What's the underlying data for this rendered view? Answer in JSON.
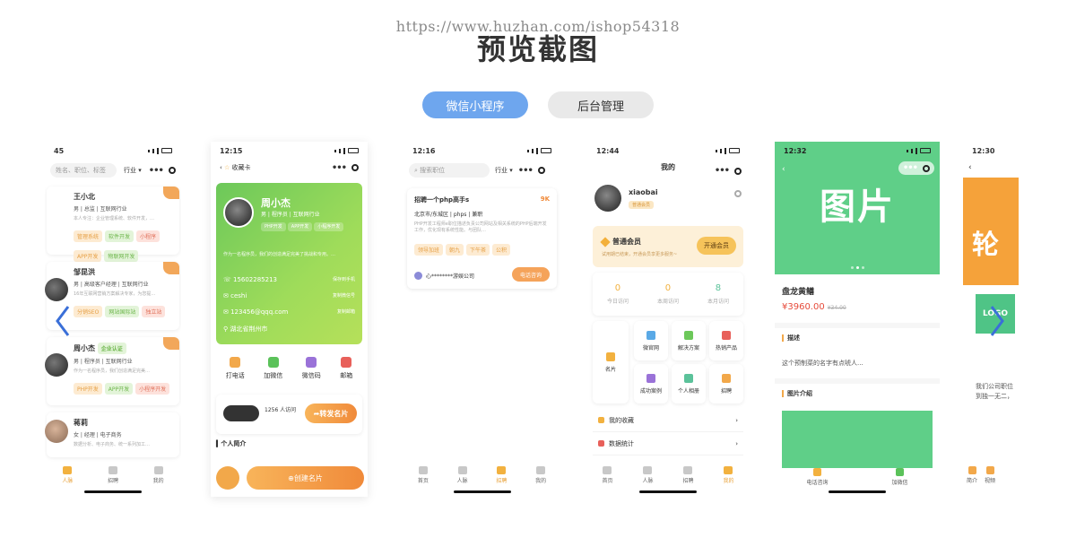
{
  "watermark": "https://www.huzhan.com/ishop54318",
  "title": "预览截图",
  "tabs": [
    {
      "label": "微信小程序",
      "active": true
    },
    {
      "label": "后台管理",
      "active": false
    }
  ],
  "colors": {
    "accent_blue": "#6ea6ee",
    "orange": "#f2a84a",
    "green": "#5fcf88"
  },
  "phone1": {
    "time": "45",
    "search_placeholder": "姓名、职位、标签",
    "filter": "行业",
    "cards": [
      {
        "name": "王小北",
        "line": "男 | 总监 | 互联网行业",
        "desc": "本人专注：企业管理系统、软件开发，…",
        "tags": [
          "管理系统",
          "软件开发",
          "小程序",
          "APP开发",
          "物联网开发"
        ]
      },
      {
        "name": "邹昆洪",
        "line": "男 | 高级客户经理 | 互联网行业",
        "desc": "16年互联网营销方案解决专家，为您提…",
        "tags": [
          "分销SEO",
          "网站国际站",
          "独立站"
        ]
      },
      {
        "name": "周小杰",
        "badge": "企业认证",
        "line": "男 | 程序员 | 互联网行业",
        "desc": "作为一名程序员，我们创造满足完美…",
        "tags": [
          "PHP开发",
          "APP开发",
          "小程序开发"
        ]
      },
      {
        "name": "蒋莉",
        "line": "女 | 经理 | 电子商务",
        "desc": "数据分析、电子商务、统一系列加工…",
        "tags": []
      }
    ],
    "tabbar": [
      "人脉",
      "招聘",
      "我的"
    ]
  },
  "phone2": {
    "time": "12:15",
    "nav_label": "收藏卡",
    "name": "周小杰",
    "line": "男 | 程序员 | 互联网行业",
    "tags": [
      "PHP开发",
      "APP开发",
      "小程序开发"
    ],
    "intro": "作为一名程序员，我们的创造满足完美了挑战和专用。…",
    "phone": "15602285213",
    "phone_action": "保存到手机",
    "wechat": "ceshi",
    "wechat_action": "复制微信号",
    "email": "123456@qqq.com",
    "email_action": "复制邮箱",
    "address": "湖北省荆州市",
    "actions": [
      "打电话",
      "加微信",
      "微信码",
      "邮箱"
    ],
    "visits": "1256 人访问",
    "share": "转发名片",
    "section": "个人简介",
    "create": "创建名片"
  },
  "phone3": {
    "time": "12:16",
    "search_placeholder": "搜索职位",
    "filter": "行业",
    "job_title": "招聘一个php高手s",
    "salary": "9K",
    "job_line": "北京市/东城区 | phps | 兼职",
    "job_desc": "PHP开发工程师e职位描述负责公司网站及相关系统的PHP后端开发工作，优化现有系统性能。与团队…",
    "job_tags": [
      "领导加班",
      "朝九",
      "下午茶",
      "公积"
    ],
    "company": "心********游娱公司",
    "consult": "电话咨询",
    "tabbar": [
      "首页",
      "人脉",
      "招聘",
      "我的"
    ]
  },
  "phone4": {
    "time": "12:44",
    "header": "我的",
    "username": "xiaobai",
    "level": "普通会员",
    "member_title": "普通会员",
    "member_sub": "试用期已结束，开通会员享更多服务~",
    "member_btn": "开通会员",
    "stats": [
      {
        "num": "0",
        "label": "今日访问"
      },
      {
        "num": "0",
        "label": "本周访问"
      },
      {
        "num": "8",
        "label": "本月访问"
      }
    ],
    "big_item": "名片",
    "grid": [
      "微官网",
      "解决方案",
      "热销产品",
      "成功案例",
      "个人相册",
      "招聘"
    ],
    "menu": [
      "我的收藏",
      "数据统计"
    ],
    "tabbar": [
      "首页",
      "人脉",
      "招聘",
      "我的"
    ]
  },
  "phone5": {
    "time": "12:32",
    "banner_text": "图片",
    "product": "盘龙黄鳝",
    "price": "¥3960.00",
    "old_price": "¥34.00",
    "desc_title": "描述",
    "desc": "这个预制菜的名字有点唬人...",
    "intro_title": "图片介绍",
    "bottom": [
      "电话咨询",
      "加微信"
    ]
  },
  "phone6": {
    "time": "12:30",
    "banner_text": "轮",
    "logo": "LOGO",
    "text_lines": [
      "我们公司职位",
      "到独一无二，"
    ],
    "bottom": [
      "简介",
      "视频"
    ]
  }
}
